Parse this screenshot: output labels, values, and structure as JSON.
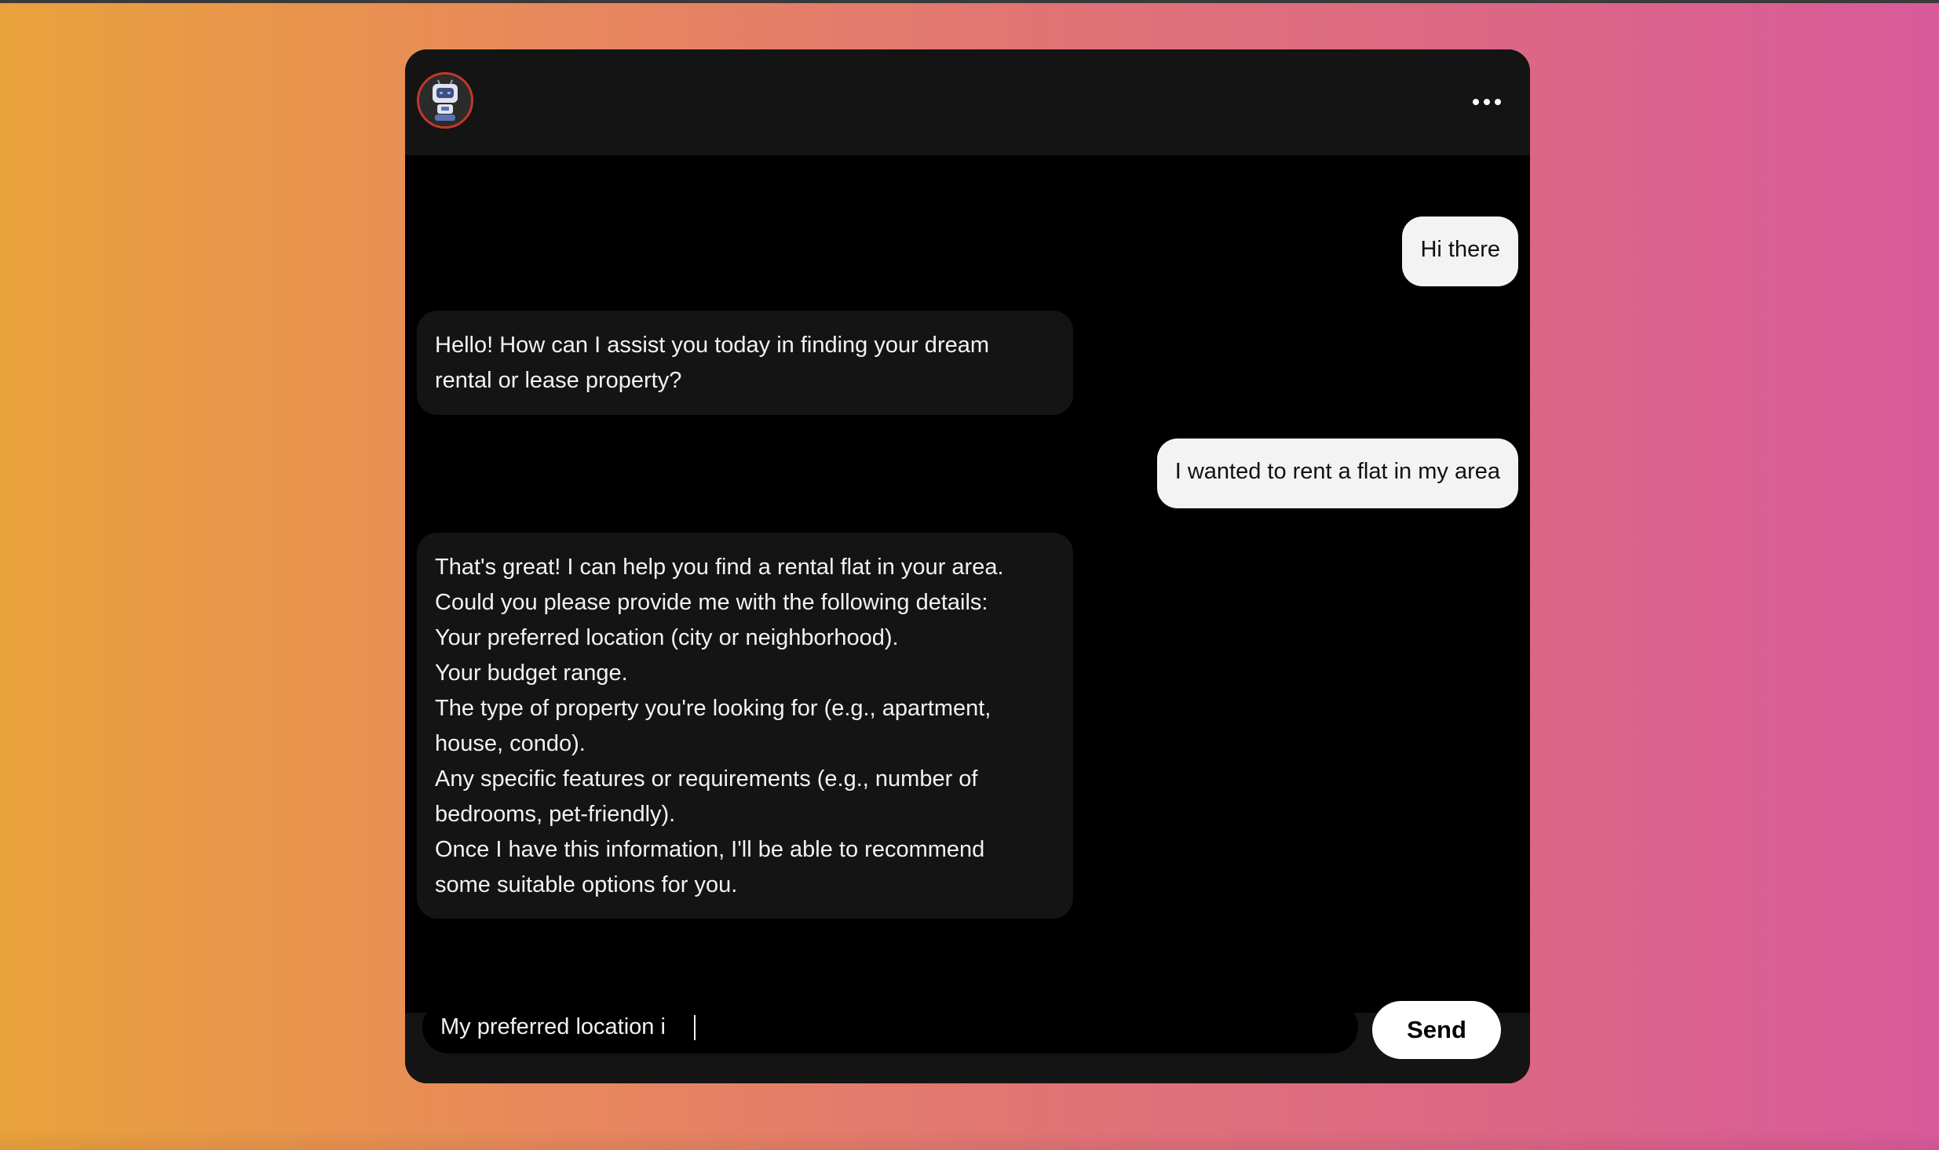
{
  "header": {
    "avatar_icon": "robot-icon",
    "menu_icon": "more-horizontal-icon"
  },
  "messages": [
    {
      "role": "user",
      "text": "Hi there"
    },
    {
      "role": "bot",
      "lines": [
        "Hello! How can I assist you today in finding your dream",
        "rental or lease property?"
      ]
    },
    {
      "role": "user",
      "text": "I wanted to rent a flat in my area"
    },
    {
      "role": "bot",
      "lines": [
        "That's great! I can help you find a rental flat in your area.",
        "Could you please provide me with the following details:",
        "Your preferred location (city or neighborhood).",
        "Your budget range.",
        "The type of property you're looking for (e.g., apartment,",
        "house, condo).",
        "Any specific features or requirements (e.g., number of",
        "bedrooms, pet-friendly).",
        "Once I have this information, I'll be able to recommend",
        "some suitable options for you."
      ]
    }
  ],
  "composer": {
    "input_value": "My preferred location i",
    "send_label": "Send"
  },
  "colors": {
    "window_bg": "#000000",
    "header_bg": "#141414",
    "bot_bubble_bg": "#141414",
    "user_bubble_bg": "#f3f3f3",
    "avatar_ring": "#c0392b"
  }
}
